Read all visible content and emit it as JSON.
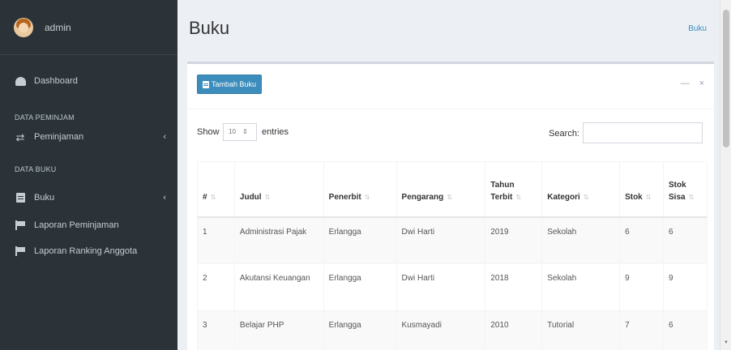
{
  "sidebar": {
    "user_name": "admin",
    "dashboard_label": "Dashboard",
    "header_peminjaman": "DATA PEMINJAM",
    "peminjaman_label": "Peminjaman",
    "header_buku": "DATA BUKU",
    "buku_label": "Buku",
    "laporan_peminjaman_label": "Laporan Peminjaman",
    "laporan_ranking_label": "Laporan Ranking Anggota",
    "chevron": "‹"
  },
  "main": {
    "page_title": "Buku",
    "breadcrumb": "Buku",
    "add_button_label": "Tambah Buku",
    "box_tools": {
      "collapse": "—",
      "remove": "×"
    },
    "show_label": "Show",
    "length_value": "10",
    "entries_label": "entries",
    "search_label": "Search:",
    "table": {
      "headers": [
        [
          "#"
        ],
        [
          "Judul"
        ],
        [
          "Penerbit"
        ],
        [
          "Pengarang"
        ],
        [
          "Tahun",
          "Terbit"
        ],
        [
          "Kategori"
        ],
        [
          "Stok"
        ],
        [
          "Stok",
          "Sisa"
        ]
      ],
      "rows": [
        [
          "1",
          "Administrasi Pajak",
          "Erlangga",
          "Dwi Harti",
          "2019",
          "Sekolah",
          "6",
          "6"
        ],
        [
          "2",
          "Akutansi Keuangan",
          "Erlangga",
          "Dwi Harti",
          "2018",
          "Sekolah",
          "9",
          "9"
        ],
        [
          "3",
          "Belajar PHP",
          "Erlangga",
          "Kusmayadi",
          "2010",
          "Tutorial",
          "7",
          "6"
        ]
      ]
    }
  }
}
